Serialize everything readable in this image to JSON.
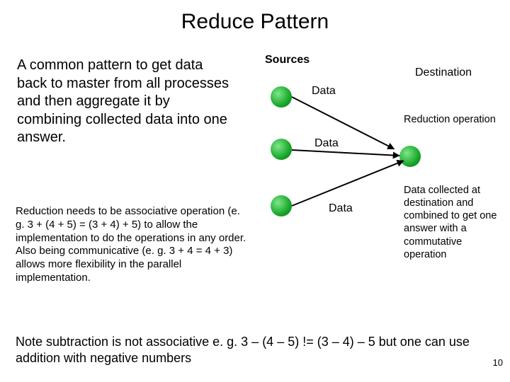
{
  "title": "Reduce Pattern",
  "intro": "A common pattern to get data back to master from all processes and then aggregate it by combining collected data into one answer.",
  "assoc": "Reduction needs to be associative operation (e. g. 3 + (4 + 5) = (3 + 4) + 5) to allow the implementation to do the operations in any order.\nAlso being communicative  (e. g. 3 + 4 = 4 + 3) allows more flexibility in the parallel implementation.",
  "footnote": "Note subtraction is not associative e. g. 3 – (4 – 5)  != (3 – 4) – 5 but one can use addition with negative numbers",
  "page_number": "10",
  "labels": {
    "sources": "Sources",
    "destination": "Destination",
    "data1": "Data",
    "data2": "Data",
    "data3": "Data",
    "reduction_op": "Reduction operation",
    "dest_blurb": "Data collected at destination and combined to get one answer with a commutative operation"
  }
}
